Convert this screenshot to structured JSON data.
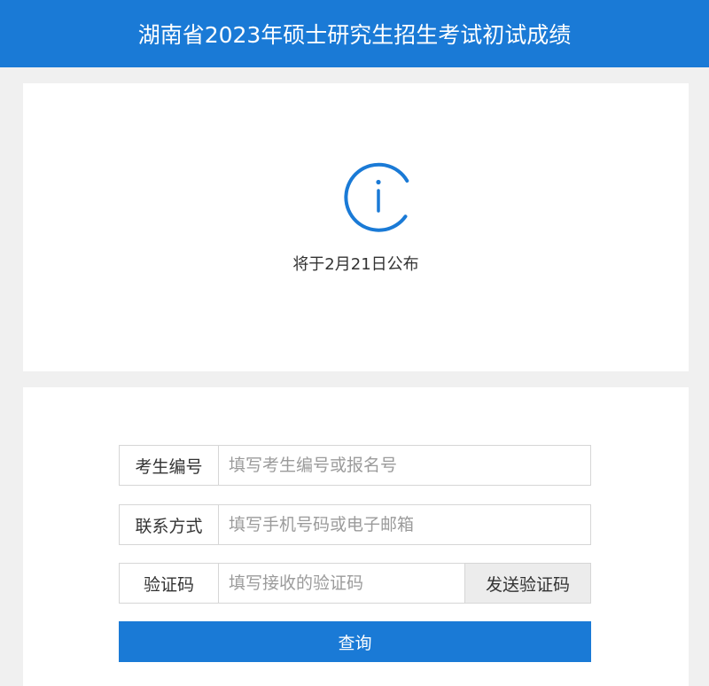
{
  "header": {
    "title": "湖南省2023年硕士研究生招生考试初试成绩"
  },
  "notice": {
    "icon": "info-icon",
    "message": "将于2月21日公布"
  },
  "form": {
    "fields": [
      {
        "label": "考生编号",
        "value": "",
        "placeholder": "填写考生编号或报名号"
      },
      {
        "label": "联系方式",
        "value": "",
        "placeholder": "填写手机号码或电子邮箱"
      },
      {
        "label": "验证码",
        "value": "",
        "placeholder": "填写接收的验证码"
      }
    ],
    "send_code_label": "发送验证码",
    "submit_label": "查询"
  },
  "colors": {
    "brand": "#1a7ad6",
    "background": "#f0f0f0",
    "card": "#ffffff",
    "border": "#d6d6d6"
  }
}
